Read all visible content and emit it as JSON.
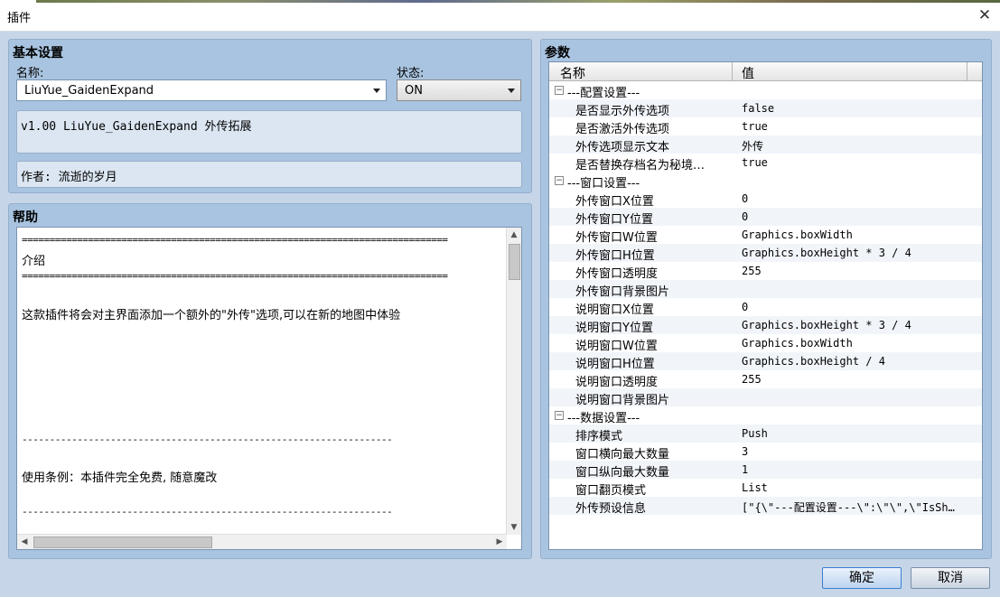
{
  "window": {
    "title": "插件",
    "close_icon": "close-icon"
  },
  "basic": {
    "title": "基本设置",
    "name_label": "名称:",
    "name_value": "LiuYue_GaidenExpand",
    "status_label": "状态:",
    "status_value": "ON",
    "description": "v1.00 LiuYue_GaidenExpand 外传拓展",
    "author": "作者: 流逝的岁月"
  },
  "help": {
    "title": "帮助",
    "lines": [
      "=============================================================================",
      "介绍",
      "=============================================================================",
      "",
      "这款插件将会对主界面添加一个额外的\"外传\"选项,可以在新的地图中体验",
      "",
      "",
      "",
      "",
      "",
      "",
      "-------------------------------------------------------------------",
      "",
      "使用条例：本插件完全免费, 随意魔改",
      "",
      "-------------------------------------------------------------------"
    ]
  },
  "params": {
    "title": "参数",
    "col_name": "名称",
    "col_value": "值",
    "rows": [
      {
        "name": "---配置设置---",
        "value": "",
        "group": true
      },
      {
        "name": "是否显示外传选项",
        "value": "false"
      },
      {
        "name": "是否激活外传选项",
        "value": "true"
      },
      {
        "name": "外传选项显示文本",
        "value": "外传"
      },
      {
        "name": "是否替换存档名为秘境…",
        "value": "true"
      },
      {
        "name": "---窗口设置---",
        "value": "",
        "group": true
      },
      {
        "name": "外传窗口X位置",
        "value": "0"
      },
      {
        "name": "外传窗口Y位置",
        "value": "0"
      },
      {
        "name": "外传窗口W位置",
        "value": "Graphics.boxWidth"
      },
      {
        "name": "外传窗口H位置",
        "value": "Graphics.boxHeight * 3 / 4"
      },
      {
        "name": "外传窗口透明度",
        "value": "255"
      },
      {
        "name": "外传窗口背景图片",
        "value": ""
      },
      {
        "name": "说明窗口X位置",
        "value": "0"
      },
      {
        "name": "说明窗口Y位置",
        "value": "Graphics.boxHeight * 3 / 4"
      },
      {
        "name": "说明窗口W位置",
        "value": "Graphics.boxWidth"
      },
      {
        "name": "说明窗口H位置",
        "value": "Graphics.boxHeight / 4"
      },
      {
        "name": "说明窗口透明度",
        "value": "255"
      },
      {
        "name": "说明窗口背景图片",
        "value": ""
      },
      {
        "name": "---数据设置---",
        "value": "",
        "group": true
      },
      {
        "name": "排序模式",
        "value": "Push"
      },
      {
        "name": "窗口横向最大数量",
        "value": "3"
      },
      {
        "name": "窗口纵向最大数量",
        "value": "1"
      },
      {
        "name": "窗口翻页模式",
        "value": "List"
      },
      {
        "name": "外传预设信息",
        "value": "[\"{\\\"---配置设置---\\\":\\\"\\\",\\\"IsSh…"
      }
    ]
  },
  "buttons": {
    "ok": "确定",
    "cancel": "取消"
  }
}
